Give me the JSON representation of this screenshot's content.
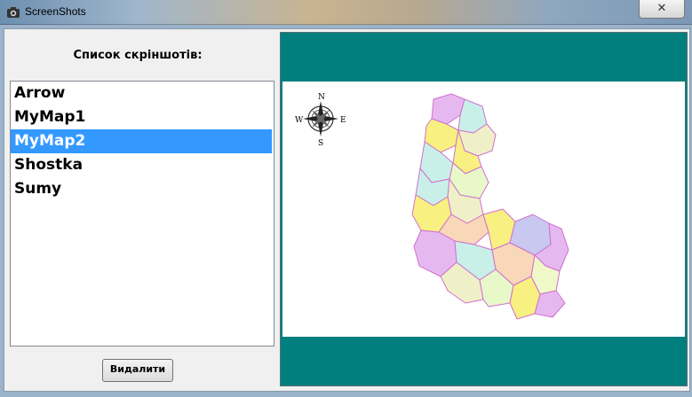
{
  "window": {
    "title": "ScreenShots",
    "close_glyph": "✕",
    "icon": "camera-icon"
  },
  "sidebar": {
    "heading": "Список скріншотів:",
    "items": [
      "Arrow",
      "MyMap1",
      "MyMap2",
      "Shostka",
      "Sumy"
    ],
    "selected_index": 2,
    "delete_label": "Видалити"
  },
  "preview": {
    "compass": {
      "n": "N",
      "s": "S",
      "e": "E",
      "w": "W"
    },
    "colors": {
      "teal": "#007f7f",
      "selection": "#3399ff"
    }
  }
}
